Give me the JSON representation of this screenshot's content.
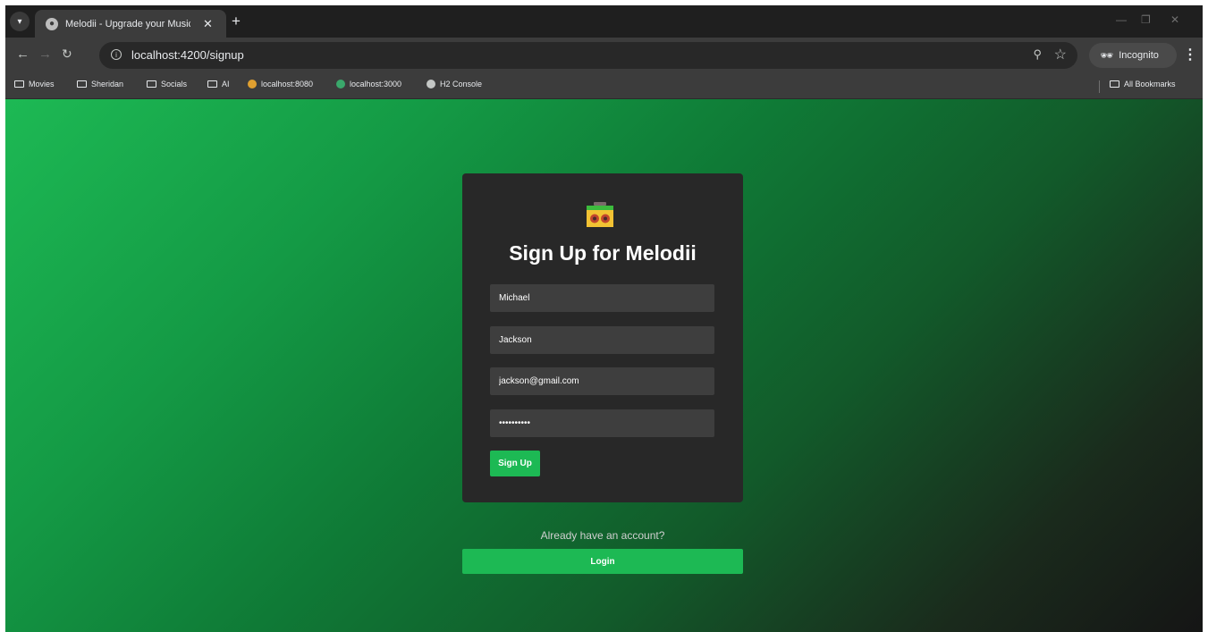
{
  "browser": {
    "tab_title": "Melodii - Upgrade your Music",
    "tab_close": "✕",
    "new_tab": "+",
    "url": "localhost:4200/signup",
    "profile_label": "Incognito",
    "bookmarks": [
      "Movies",
      "Sheridan",
      "Socials",
      "AI",
      "localhost:8080",
      "localhost:3000",
      "H2 Console"
    ],
    "all_bookmarks": "All Bookmarks",
    "icons": [
      "tab-search-icon",
      "back-icon",
      "forward-icon",
      "reload-icon",
      "site-info-icon",
      "zoom-icon",
      "star-icon",
      "incognito-icon",
      "menu-icon",
      "folder-icon"
    ]
  },
  "signup": {
    "title": "Sign Up for Melodii",
    "first_name": "Michael",
    "last_name": "Jackson",
    "email": "jackson@gmail.com",
    "password": "••••••••••",
    "submit_label": "Sign Up",
    "already_text": "Already have an account?",
    "login_label": "Login"
  },
  "colors": {
    "accent": "#1db954",
    "card": "#282828",
    "input": "#3e3e3e"
  }
}
